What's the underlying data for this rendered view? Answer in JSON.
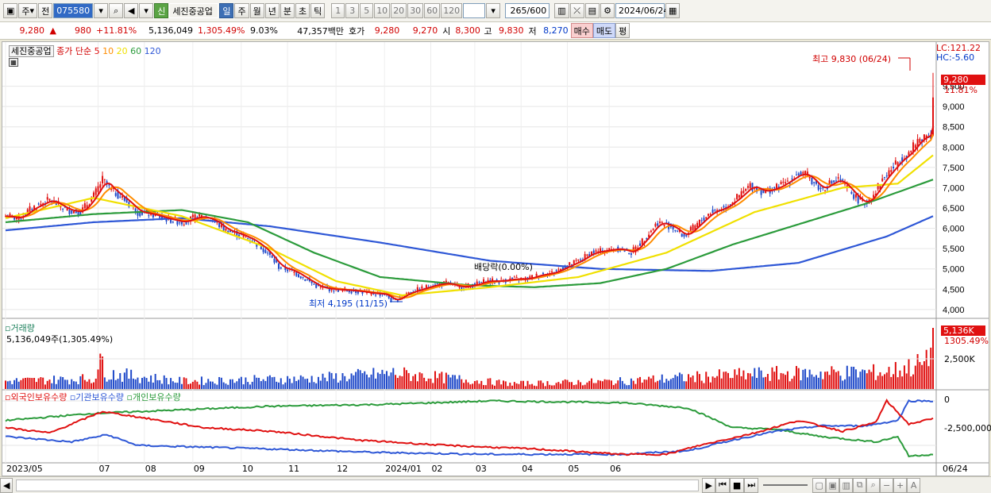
{
  "toolbar": {
    "type_label": "주",
    "prev_label": "전",
    "code": "075580",
    "tag_new": "신",
    "stock_name": "세진중공업",
    "periods": [
      "일",
      "주",
      "월",
      "년",
      "분",
      "초",
      "틱"
    ],
    "active_period": "일",
    "intervals": [
      "1",
      "3",
      "5",
      "10",
      "20",
      "30",
      "60",
      "120"
    ],
    "count_value": "265",
    "count_total": "/600",
    "date": "2024/06/24"
  },
  "quote": {
    "price": "9,280",
    "change": "980",
    "change_pct": "+11.81%",
    "volume": "5,136,049",
    "volume_pct": "1,305.49%",
    "turnover": "9.03%",
    "amount": "47,357백만",
    "bid_label": "호가",
    "bid_sell": "9,280",
    "bid_buy": "9,270",
    "open_label": "시",
    "open": "8,300",
    "high_label": "고",
    "high": "9,830",
    "low_label": "저",
    "low": "8,270",
    "buy_button": "매수",
    "sell_button": "매도",
    "eval_button": "평"
  },
  "price_panel": {
    "stock_tag": "세진중공업",
    "ma_label": "종가 단순",
    "ma_periods": [
      "5",
      "10",
      "20",
      "60",
      "120"
    ],
    "ma_colors": [
      "#e01010",
      "#ff8c00",
      "#f0e000",
      "#2b9b3b",
      "#2e57d6"
    ],
    "lc": "LC:121.22",
    "hc": "HC:-5.60",
    "high_note": "최고 9,830 (06/24)",
    "low_note": "최저 4,195 (11/15)",
    "dividend_note": "배당락(0.00%)",
    "last_price": "9,280",
    "last_pct": "11.81%"
  },
  "volume_panel": {
    "title": "거래량",
    "value_text": "5,136,049주(1,305.49%)",
    "last_value": "5,136K",
    "last_pct": "1305.49%",
    "axis_label": "2,500K"
  },
  "holder_panel": {
    "series": [
      "외국인보유수량",
      "기관보유수량",
      "개인보유수량"
    ],
    "series_colors": [
      "#e01010",
      "#2e57d6",
      "#2b9b3b"
    ],
    "axis_labels": [
      "0",
      "-2,500,000"
    ]
  },
  "x_axis": [
    "2023/05",
    "07",
    "08",
    "09",
    "10",
    "11",
    "12",
    "2024/01",
    "02",
    "03",
    "04",
    "05",
    "06"
  ],
  "x_axis_end": "06/24",
  "colors": {
    "up": "#e01010",
    "down": "#1f49c9",
    "accent": "#316ac5"
  },
  "chart_data": {
    "type": "line",
    "ylim": [
      3900,
      10000
    ],
    "yticks": [
      4000,
      4500,
      5000,
      5500,
      6000,
      6500,
      7000,
      7500,
      8000,
      8500,
      9000,
      9500
    ],
    "close_anchors": [
      [
        0,
        6300
      ],
      [
        6,
        6250
      ],
      [
        12,
        6500
      ],
      [
        20,
        6700
      ],
      [
        28,
        6450
      ],
      [
        34,
        6400
      ],
      [
        40,
        6800
      ],
      [
        44,
        7200
      ],
      [
        48,
        6950
      ],
      [
        54,
        6700
      ],
      [
        60,
        6400
      ],
      [
        66,
        6350
      ],
      [
        72,
        6250
      ],
      [
        80,
        6150
      ],
      [
        88,
        6300
      ],
      [
        94,
        6200
      ],
      [
        100,
        5950
      ],
      [
        106,
        5850
      ],
      [
        112,
        5700
      ],
      [
        118,
        5450
      ],
      [
        124,
        5050
      ],
      [
        130,
        4950
      ],
      [
        136,
        4750
      ],
      [
        142,
        4550
      ],
      [
        148,
        4500
      ],
      [
        154,
        4480
      ],
      [
        160,
        4450
      ],
      [
        166,
        4400
      ],
      [
        172,
        4380
      ],
      [
        176,
        4200
      ],
      [
        182,
        4400
      ],
      [
        188,
        4500
      ],
      [
        194,
        4600
      ],
      [
        200,
        4650
      ],
      [
        206,
        4550
      ],
      [
        212,
        4600
      ],
      [
        218,
        4700
      ],
      [
        224,
        4700
      ],
      [
        230,
        4750
      ],
      [
        236,
        4750
      ],
      [
        242,
        4850
      ],
      [
        248,
        4900
      ],
      [
        254,
        5050
      ],
      [
        260,
        5200
      ],
      [
        266,
        5400
      ],
      [
        272,
        5450
      ],
      [
        278,
        5500
      ],
      [
        284,
        5400
      ],
      [
        290,
        5750
      ],
      [
        296,
        6150
      ],
      [
        302,
        6050
      ],
      [
        308,
        5800
      ],
      [
        314,
        6100
      ],
      [
        320,
        6400
      ],
      [
        326,
        6500
      ],
      [
        332,
        6750
      ],
      [
        338,
        7050
      ],
      [
        344,
        6900
      ],
      [
        350,
        7000
      ],
      [
        356,
        7200
      ],
      [
        360,
        7350
      ],
      [
        364,
        7300
      ],
      [
        370,
        6950
      ],
      [
        374,
        7100
      ],
      [
        378,
        7200
      ],
      [
        382,
        7000
      ],
      [
        386,
        6750
      ],
      [
        390,
        6600
      ],
      [
        394,
        6850
      ],
      [
        398,
        7200
      ],
      [
        402,
        7450
      ],
      [
        406,
        7700
      ],
      [
        410,
        7850
      ],
      [
        414,
        8150
      ],
      [
        418,
        8300
      ],
      [
        420,
        8300
      ],
      [
        421,
        9280
      ]
    ],
    "ma_lines": {
      "MA120": [
        [
          0,
          5950
        ],
        [
          40,
          6150
        ],
        [
          80,
          6250
        ],
        [
          120,
          6050
        ],
        [
          170,
          5650
        ],
        [
          220,
          5200
        ],
        [
          270,
          5000
        ],
        [
          320,
          4950
        ],
        [
          360,
          5150
        ],
        [
          400,
          5800
        ],
        [
          421,
          6300
        ]
      ],
      "MA60": [
        [
          0,
          6150
        ],
        [
          40,
          6350
        ],
        [
          80,
          6450
        ],
        [
          110,
          6150
        ],
        [
          140,
          5400
        ],
        [
          170,
          4800
        ],
        [
          210,
          4600
        ],
        [
          240,
          4550
        ],
        [
          270,
          4650
        ],
        [
          300,
          5000
        ],
        [
          330,
          5600
        ],
        [
          360,
          6100
        ],
        [
          390,
          6600
        ],
        [
          421,
          7200
        ]
      ],
      "MA20": [
        [
          0,
          6250
        ],
        [
          40,
          6750
        ],
        [
          80,
          6300
        ],
        [
          120,
          5500
        ],
        [
          150,
          4700
        ],
        [
          180,
          4350
        ],
        [
          220,
          4550
        ],
        [
          260,
          4800
        ],
        [
          300,
          5400
        ],
        [
          340,
          6400
        ],
        [
          380,
          7000
        ],
        [
          405,
          7100
        ],
        [
          421,
          7800
        ]
      ]
    },
    "volume_anchors": [
      [
        0,
        0.15
      ],
      [
        40,
        0.2
      ],
      [
        44,
        0.55
      ],
      [
        46,
        0.3
      ],
      [
        80,
        0.15
      ],
      [
        140,
        0.2
      ],
      [
        176,
        0.3
      ],
      [
        230,
        0.1
      ],
      [
        280,
        0.15
      ],
      [
        300,
        0.2
      ],
      [
        340,
        0.28
      ],
      [
        360,
        0.3
      ],
      [
        400,
        0.32
      ],
      [
        418,
        0.5
      ],
      [
        421,
        1.0
      ]
    ],
    "foreign_anchors": [
      [
        0,
        -1500000
      ],
      [
        20,
        -1800000
      ],
      [
        44,
        -600000
      ],
      [
        60,
        -900000
      ],
      [
        90,
        -1500000
      ],
      [
        120,
        -1700000
      ],
      [
        160,
        -2200000
      ],
      [
        200,
        -2500000
      ],
      [
        240,
        -2700000
      ],
      [
        280,
        -3000000
      ],
      [
        300,
        -3000000
      ],
      [
        315,
        -2500000
      ],
      [
        340,
        -1800000
      ],
      [
        360,
        -1100000
      ],
      [
        380,
        -1700000
      ],
      [
        395,
        -1200000
      ],
      [
        400,
        0
      ],
      [
        410,
        -1300000
      ],
      [
        421,
        -1000000
      ]
    ],
    "inst_anchors": [
      [
        0,
        -2000000
      ],
      [
        30,
        -2300000
      ],
      [
        46,
        -1900000
      ],
      [
        60,
        -2500000
      ],
      [
        120,
        -2700000
      ],
      [
        170,
        -2900000
      ],
      [
        220,
        -3000000
      ],
      [
        280,
        -3000000
      ],
      [
        310,
        -2800000
      ],
      [
        330,
        -2200000
      ],
      [
        350,
        -1700000
      ],
      [
        370,
        -1400000
      ],
      [
        390,
        -1400000
      ],
      [
        405,
        -1100000
      ],
      [
        410,
        0
      ],
      [
        421,
        0
      ]
    ],
    "retail_anchors": [
      [
        0,
        -1100000
      ],
      [
        40,
        -700000
      ],
      [
        80,
        -500000
      ],
      [
        120,
        -300000
      ],
      [
        170,
        -200000
      ],
      [
        220,
        0
      ],
      [
        280,
        -100000
      ],
      [
        310,
        -400000
      ],
      [
        330,
        -1500000
      ],
      [
        350,
        -1600000
      ],
      [
        370,
        -2000000
      ],
      [
        395,
        -2300000
      ],
      [
        405,
        -2000000
      ],
      [
        410,
        -3100000
      ],
      [
        421,
        -3000000
      ]
    ]
  }
}
